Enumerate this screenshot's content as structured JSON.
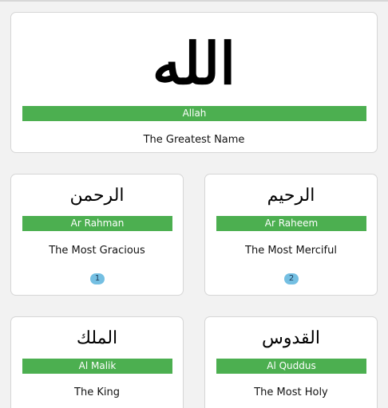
{
  "hero": {
    "arabic": "الله",
    "transliteration": "Allah",
    "meaning": "The Greatest Name"
  },
  "names": [
    {
      "arabic": "الرحمن",
      "transliteration": "Ar Rahman",
      "meaning": "The Most Gracious",
      "number": "1"
    },
    {
      "arabic": "الرحيم",
      "transliteration": "Ar Raheem",
      "meaning": "The Most Merciful",
      "number": "2"
    },
    {
      "arabic": "الملك",
      "transliteration": "Al Malik",
      "meaning": "The King"
    },
    {
      "arabic": "القدوس",
      "transliteration": "Al Quddus",
      "meaning": "The Most Holy"
    }
  ],
  "colors": {
    "accent_bar": "#4caf50",
    "badge": "#74bfe2",
    "card_bg": "#ffffff",
    "page_bg": "#f2f2f2"
  }
}
